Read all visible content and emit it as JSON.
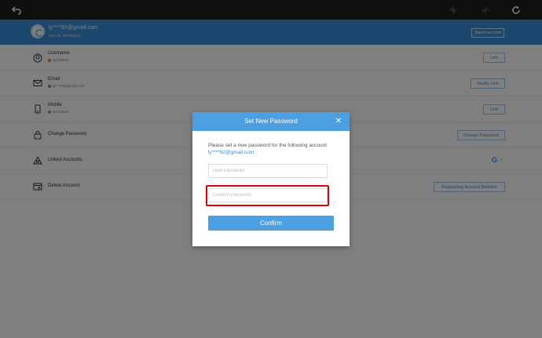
{
  "topbar": {
    "back_icon": "back-arrow-icon",
    "icons": [
      "connect-icon",
      "disconnect-icon",
      "refresh-icon"
    ]
  },
  "account": {
    "email": "ly****92@gmail.com",
    "user_id": "User ID: 207208504",
    "switch_label": "Switch account"
  },
  "rows": [
    {
      "label": "Username",
      "status": "Not linked",
      "status_color": "#f07c23",
      "button": "Link",
      "icon": "user-icon"
    },
    {
      "label": "Email",
      "status": "ly****92@gmail.com",
      "status_color": "#4caf50",
      "button": "Modify Link",
      "icon": "mail-icon"
    },
    {
      "label": "Mobile",
      "status": "Not linked",
      "status_color": "#f07c23",
      "button": "Link",
      "icon": "phone-icon"
    },
    {
      "label": "Change Password",
      "button": "Change Password",
      "icon": "lock-icon"
    },
    {
      "label": "Linked Accounts",
      "icon": "linked-accounts-icon",
      "trailing_icon": "google-icon"
    },
    {
      "label": "Delete Account",
      "button": "Requesting Account Deletion",
      "icon": "delete-account-icon"
    }
  ],
  "modal": {
    "title": "Set New Password",
    "description": "Please set a new password for the following account",
    "email": "ly****92@gmail.com",
    "new_password_placeholder": "New Password",
    "confirm_password_placeholder": "Confirm Password",
    "confirm_label": "Confirm"
  },
  "colors": {
    "accent": "#4c9fe0",
    "header_blue": "#3b8fd9",
    "highlight": "#e00000"
  }
}
